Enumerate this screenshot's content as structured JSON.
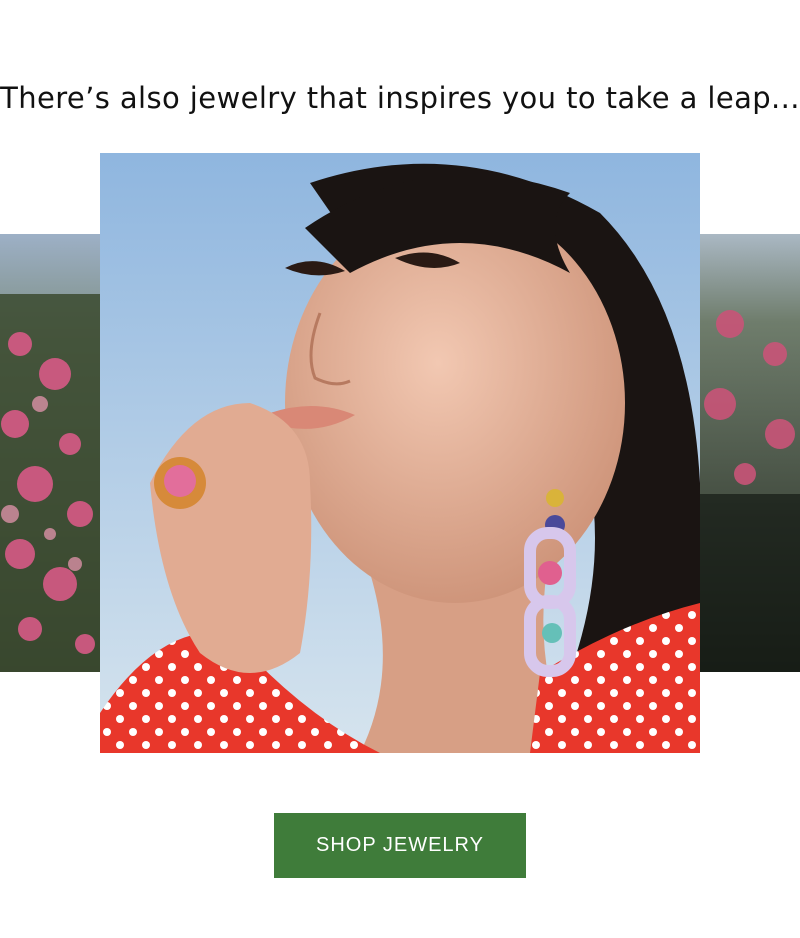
{
  "headline": "There’s also jewelry that inspires you to take a leap...",
  "images": {
    "hero": {
      "description_icon": "portrait-photo-icon"
    },
    "left": {
      "description_icon": "flowers-photo-icon"
    },
    "right": {
      "description_icon": "flowers-photo-icon"
    }
  },
  "cta": {
    "label": "SHOP JEWELRY",
    "bg_color": "#3f7c3a",
    "text_color": "#ffffff"
  },
  "colors": {
    "sky": "#a8c8e6",
    "dress": "#e8372b",
    "hair": "#1a1412",
    "skin": "#e6b49b"
  }
}
